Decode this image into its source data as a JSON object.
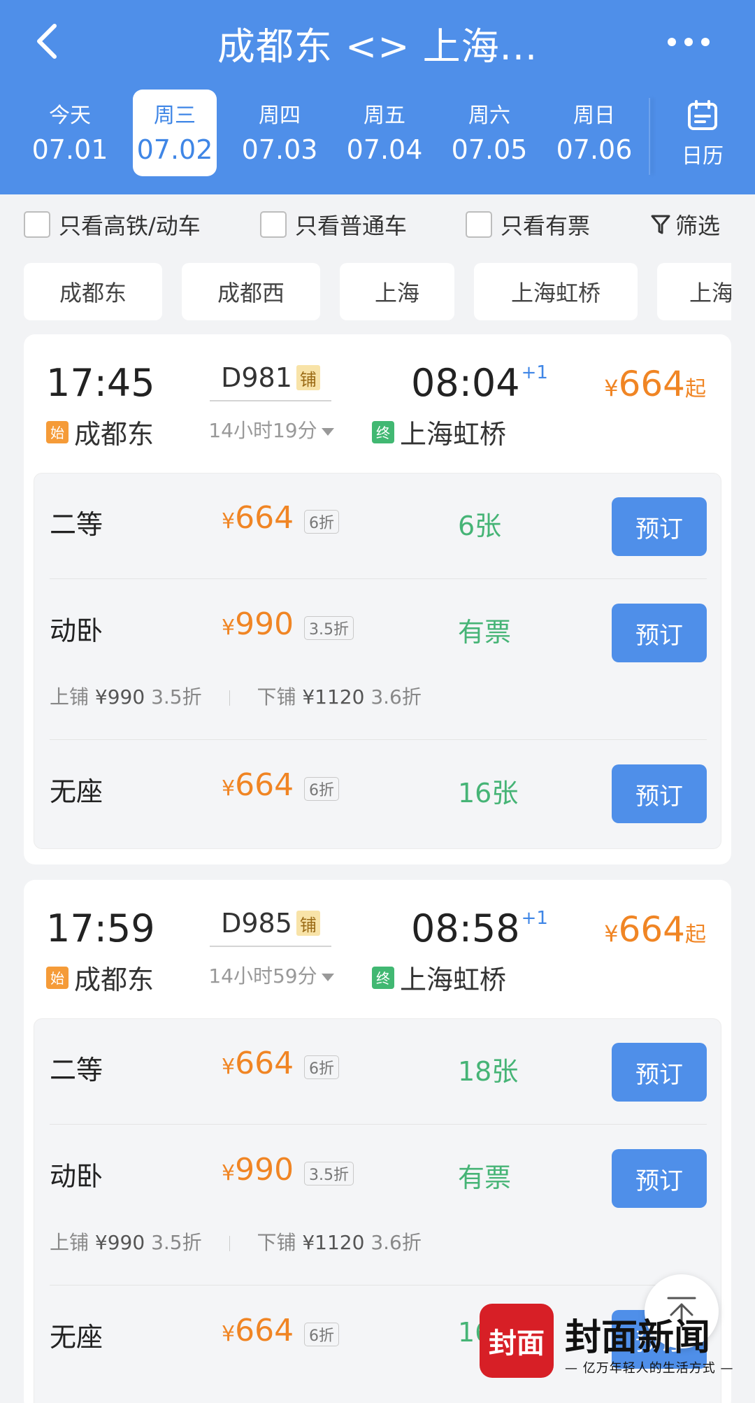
{
  "header": {
    "title": "成都东 <> 上海...",
    "background_color": "#4f8fe9",
    "back_icon": "chevron-left-icon",
    "more_icon": "more-dots-icon"
  },
  "dates": [
    {
      "weekday": "今天",
      "date": "07.01",
      "active": false
    },
    {
      "weekday": "周三",
      "date": "07.02",
      "active": true
    },
    {
      "weekday": "周四",
      "date": "07.03",
      "active": false
    },
    {
      "weekday": "周五",
      "date": "07.04",
      "active": false
    },
    {
      "weekday": "周六",
      "date": "07.05",
      "active": false
    },
    {
      "weekday": "周日",
      "date": "07.06",
      "active": false
    }
  ],
  "calendar": {
    "label": "日历",
    "icon": "calendar-icon"
  },
  "filters": {
    "high_speed": "只看高铁/动车",
    "normal": "只看普通车",
    "available": "只看有票",
    "sift": "筛选",
    "sift_icon": "funnel-icon"
  },
  "stations": [
    "成都东",
    "成都西",
    "上海",
    "上海虹桥",
    "上海"
  ],
  "trains": [
    {
      "dep_time": "17:45",
      "dep_station": "成都东",
      "dep_tag": "始",
      "train_no": "D981",
      "sleeper_tag": "铺",
      "duration": "14小时19分",
      "arr_time": "08:04",
      "arr_plus": "+1",
      "arr_station": "上海虹桥",
      "arr_tag": "终",
      "min_price_yen": "¥",
      "min_price": "664",
      "min_price_suffix": "起",
      "seats": [
        {
          "name": "二等",
          "yen": "¥",
          "price": "664",
          "discount": "6折",
          "count": "6张",
          "button": "预订"
        },
        {
          "name": "动卧",
          "yen": "¥",
          "price": "990",
          "discount": "3.5折",
          "count": "有票",
          "button": "预订",
          "berth": {
            "upper_label": "上铺",
            "upper_price": "¥990",
            "upper_disc": "3.5折",
            "lower_label": "下铺",
            "lower_price": "¥1120",
            "lower_disc": "3.6折"
          }
        },
        {
          "name": "无座",
          "yen": "¥",
          "price": "664",
          "discount": "6折",
          "count": "16张",
          "button": "预订"
        }
      ]
    },
    {
      "dep_time": "17:59",
      "dep_station": "成都东",
      "dep_tag": "始",
      "train_no": "D985",
      "sleeper_tag": "铺",
      "duration": "14小时59分",
      "arr_time": "08:58",
      "arr_plus": "+1",
      "arr_station": "上海虹桥",
      "arr_tag": "终",
      "min_price_yen": "¥",
      "min_price": "664",
      "min_price_suffix": "起",
      "seats": [
        {
          "name": "二等",
          "yen": "¥",
          "price": "664",
          "discount": "6折",
          "count": "18张",
          "button": "预订"
        },
        {
          "name": "动卧",
          "yen": "¥",
          "price": "990",
          "discount": "3.5折",
          "count": "有票",
          "button": "预订",
          "berth": {
            "upper_label": "上铺",
            "upper_price": "¥990",
            "upper_disc": "3.5折",
            "lower_label": "下铺",
            "lower_price": "¥1120",
            "lower_disc": "3.6折"
          }
        },
        {
          "name": "无座",
          "yen": "¥",
          "price": "664",
          "discount": "6折",
          "count": "16",
          "button": "预订"
        }
      ]
    }
  ],
  "watermark": {
    "badge": "封面",
    "name": "封面新闻",
    "slogan": "— 亿万年轻人的生活方式 —"
  },
  "to_top_icon": "back-to-top-icon"
}
